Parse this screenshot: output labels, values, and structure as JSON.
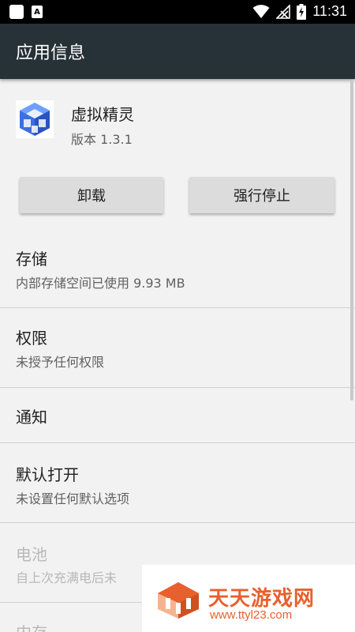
{
  "status_bar": {
    "time": "11:31",
    "notification_a": "A"
  },
  "app_bar": {
    "title": "应用信息"
  },
  "app": {
    "name": "虚拟精灵",
    "version": "版本 1.3.1"
  },
  "buttons": {
    "uninstall": "卸载",
    "force_stop": "强行停止"
  },
  "items": [
    {
      "title": "存储",
      "subtitle": "内部存储空间已使用 9.93 MB",
      "enabled": true
    },
    {
      "title": "权限",
      "subtitle": "未授予任何权限",
      "enabled": true
    },
    {
      "title": "通知",
      "subtitle": "",
      "enabled": true
    },
    {
      "title": "默认打开",
      "subtitle": "未设置任何默认选项",
      "enabled": true
    },
    {
      "title": "电池",
      "subtitle": "自上次充满电后未",
      "enabled": false
    },
    {
      "title": "内存",
      "subtitle": "",
      "enabled": false
    }
  ],
  "watermark": {
    "title": "天天游戏网",
    "url": "www.ttyl23.com"
  },
  "colors": {
    "app_bar": "#263238",
    "status_bar": "#000000",
    "background": "#f2f2f2",
    "button": "#dcdcdc",
    "watermark_accent": "#e8602d",
    "app_icon": "#3d6fe0"
  }
}
